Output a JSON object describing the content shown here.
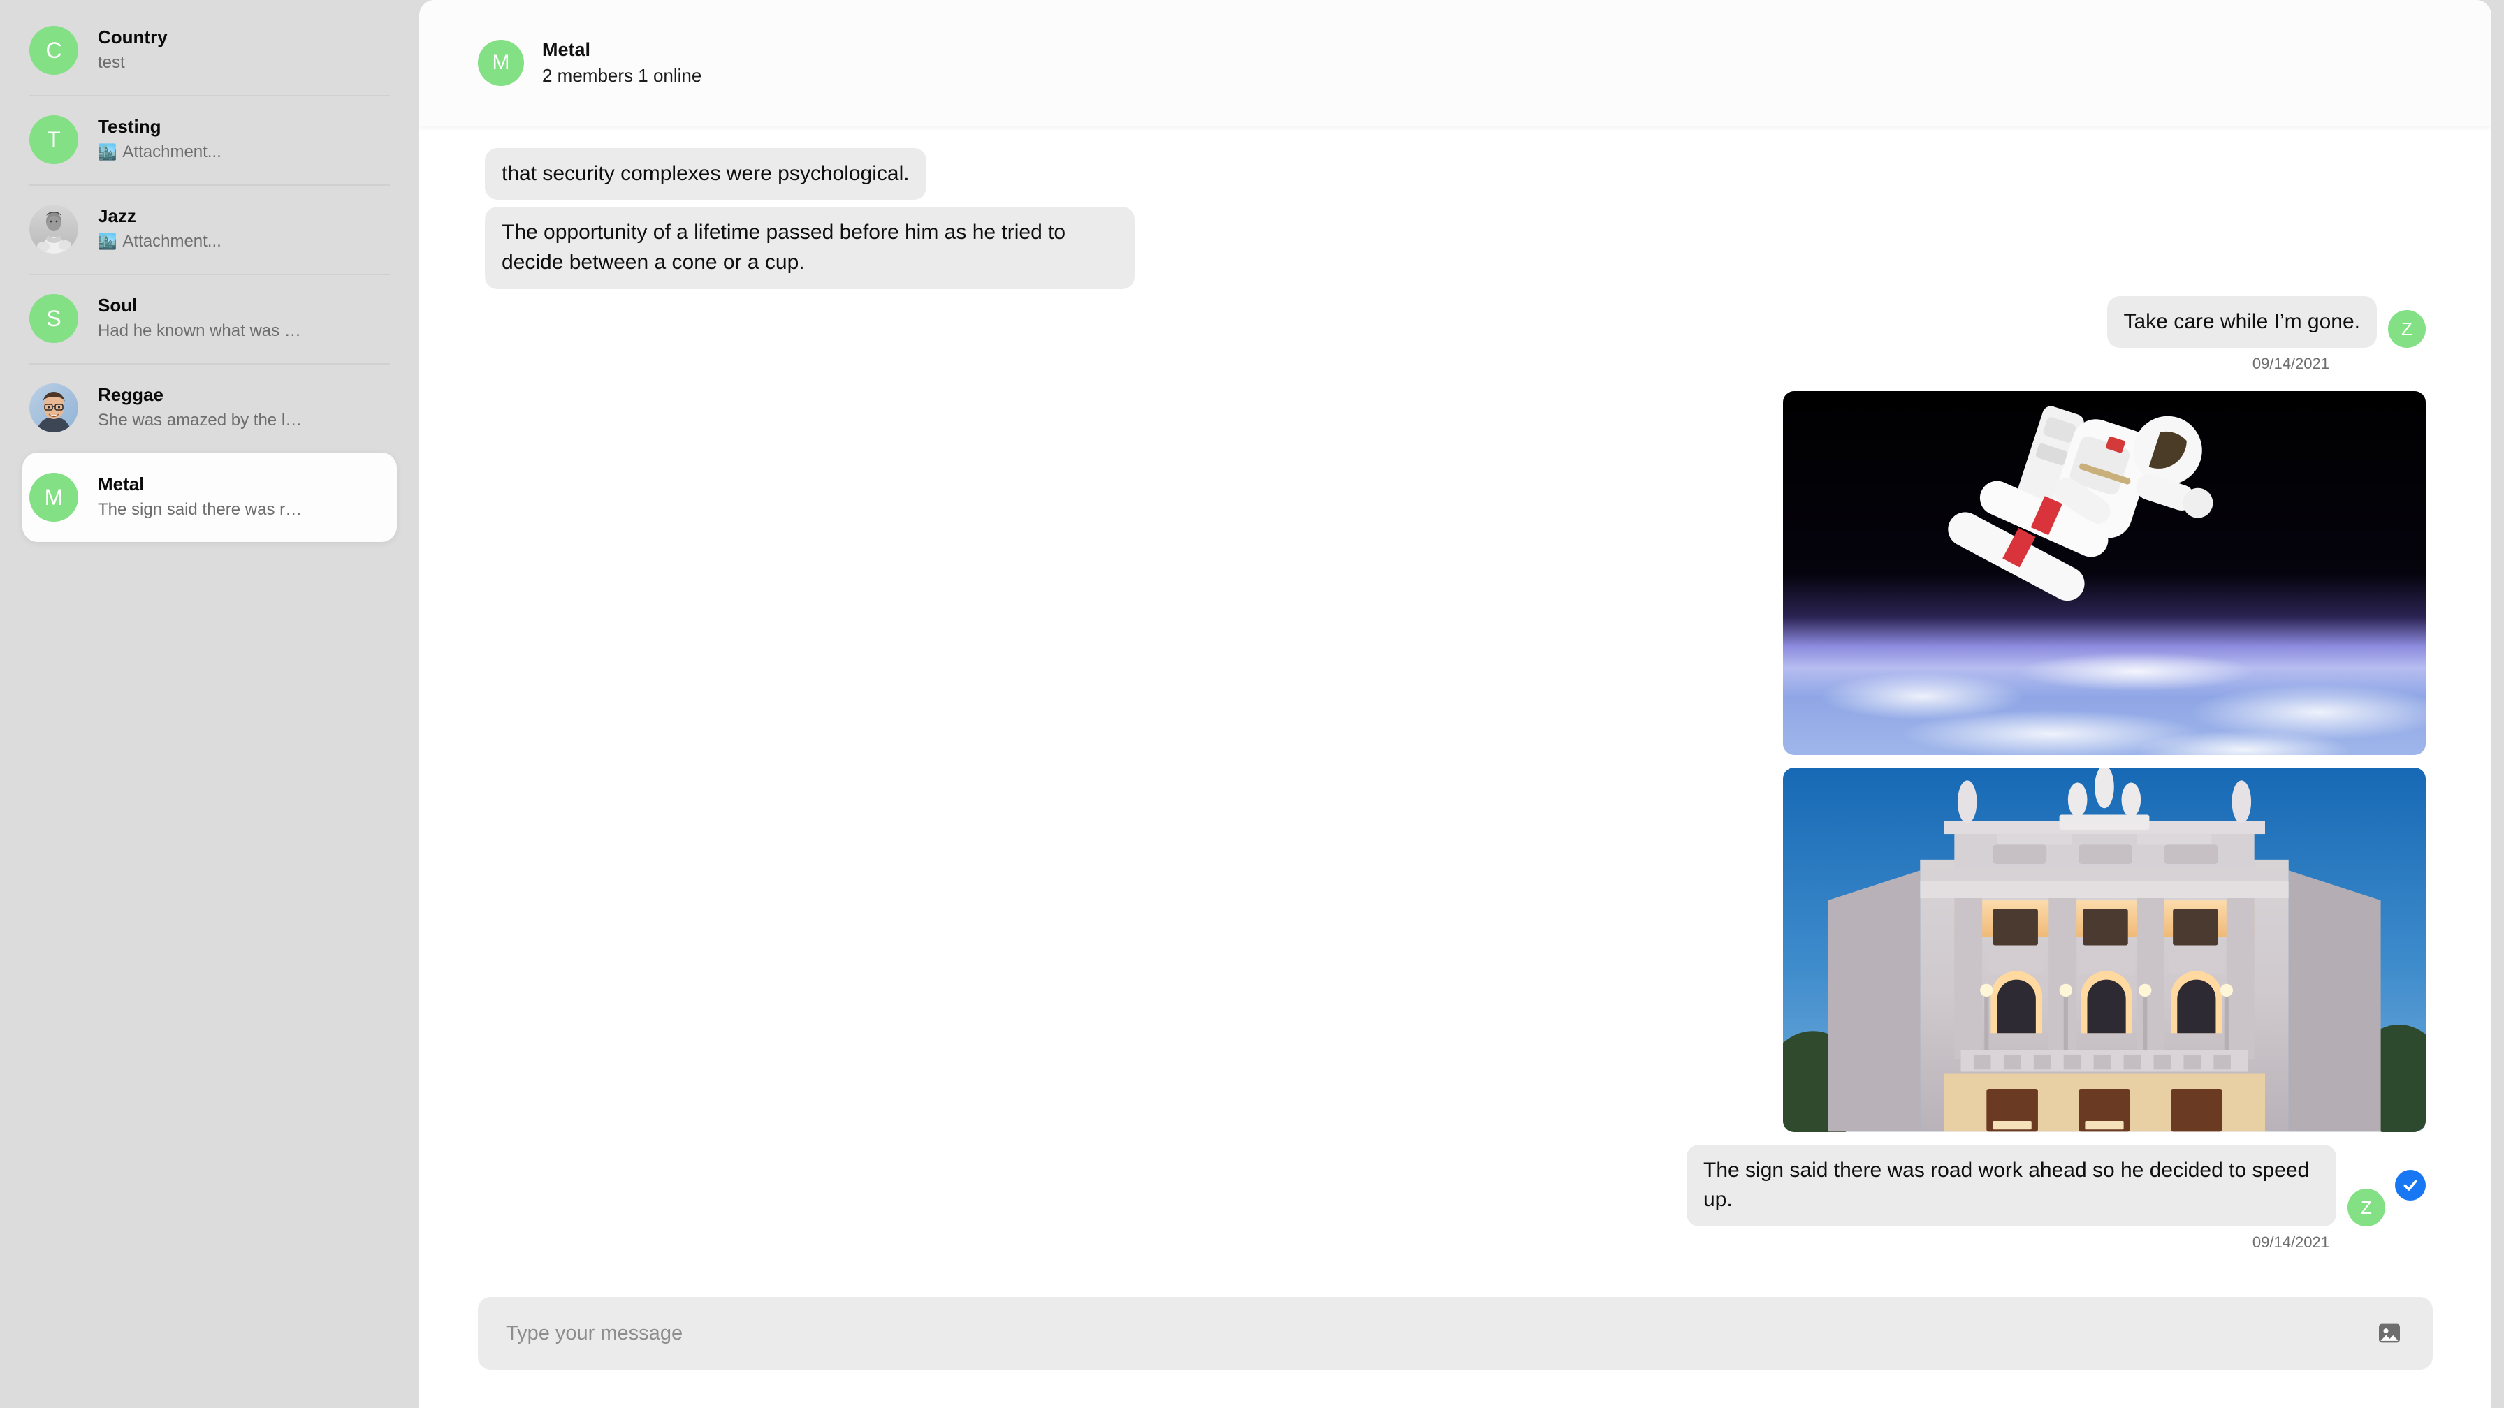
{
  "sidebar": {
    "conversations": [
      {
        "name": "Country",
        "preview": "test",
        "avatar_kind": "initial",
        "initial": "C",
        "avatar_color": "#83e085",
        "has_attachment": false
      },
      {
        "name": "Testing",
        "preview": "Attachment...",
        "avatar_kind": "initial",
        "initial": "T",
        "avatar_color": "#83e085",
        "has_attachment": true,
        "attachment_icon": "cityscape-emoji"
      },
      {
        "name": "Jazz",
        "preview": "Attachment...",
        "avatar_kind": "photo",
        "initial": "J",
        "avatar_photo": "grayscale-man-portrait",
        "has_attachment": true,
        "attachment_icon": "cityscape-emoji"
      },
      {
        "name": "Soul",
        "preview": "Had he known what was …",
        "avatar_kind": "initial",
        "initial": "S",
        "avatar_color": "#83e085",
        "has_attachment": false
      },
      {
        "name": "Reggae",
        "preview": "She was amazed by the l…",
        "avatar_kind": "photo",
        "initial": "R",
        "avatar_photo": "man-with-glasses-portrait",
        "has_attachment": false
      },
      {
        "name": "Metal",
        "preview": "The sign said there was r…",
        "avatar_kind": "initial",
        "initial": "M",
        "avatar_color": "#83e085",
        "has_attachment": false,
        "selected": true
      }
    ]
  },
  "header": {
    "avatar_initial": "M",
    "title": "Metal",
    "subtitle": "2 members 1 online"
  },
  "messages": [
    {
      "id": "m1",
      "direction": "in",
      "type": "text",
      "text": "that security complexes were psychological.",
      "clipped": true
    },
    {
      "id": "m2",
      "direction": "in",
      "type": "text",
      "text": "The opportunity of a lifetime passed before him as he tried to decide between a cone or a cup."
    },
    {
      "id": "m3",
      "direction": "out",
      "type": "text",
      "text": "Take care while I’m gone.",
      "avatar_initial": "Z",
      "timestamp": "09/14/2021"
    },
    {
      "id": "m4",
      "direction": "out",
      "type": "image",
      "image": "astronaut-spacewalk-above-earth"
    },
    {
      "id": "m5",
      "direction": "out",
      "type": "image",
      "image": "illuminated-neoclassical-building-at-dusk"
    },
    {
      "id": "m6",
      "direction": "out",
      "type": "text",
      "text": "The sign said there was road work ahead so he decided to speed up.",
      "avatar_initial": "Z",
      "delivered": true,
      "timestamp": "09/14/2021"
    }
  ],
  "composer": {
    "value": "",
    "placeholder": "Type your message",
    "attach_icon": "image-icon"
  },
  "colors": {
    "accent_green": "#83e085",
    "delivered_blue": "#1877f2",
    "bubble_gray": "#ebebeb",
    "app_background": "#dcdcdc",
    "panel_white": "#ffffff"
  }
}
